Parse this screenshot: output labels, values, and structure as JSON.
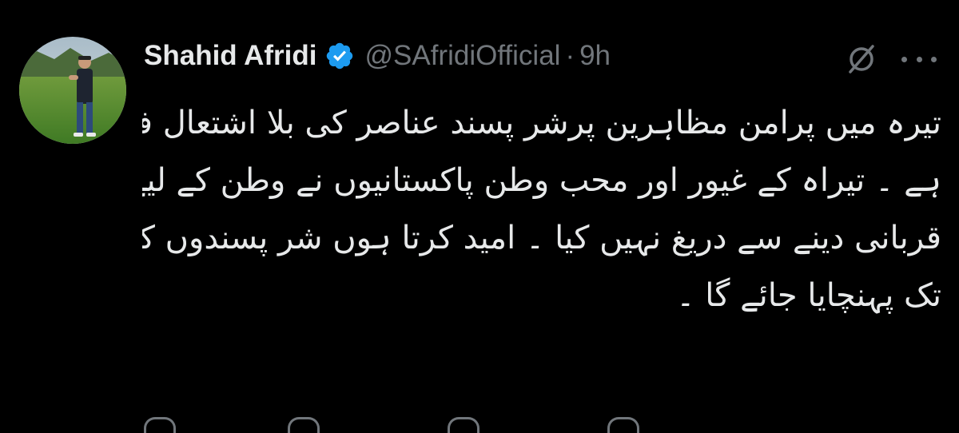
{
  "author": {
    "name": "Shahid Afridi",
    "handle": "@SAfridiOfficial",
    "separator": "·",
    "time": "9h",
    "verified": true
  },
  "tweet": {
    "lines": [
      "تیرہ میں پرامن مظاہرین پرشر پسند عناصر کی بلا اشتعال فائرنگ قابل مُزمت",
      "ہے ۔ تیراہ کے غیور اور محب وطن پاکستانیوں نے وطن کے لیے کبھی",
      "قربانی دینے سے دریغ نہیں کیا ۔ امید کرتا ہوں شر پسندوں کو جلد کیفر کرادر",
      "تک پہنچایا جائے گا ۔"
    ]
  },
  "icons": {
    "verified": "verified-badge-icon",
    "grok": "grok-icon",
    "more": "more-icon"
  },
  "colors": {
    "background": "#000000",
    "text": "#e7e9ea",
    "muted": "#71767b",
    "verified": "#1d9bf0"
  }
}
